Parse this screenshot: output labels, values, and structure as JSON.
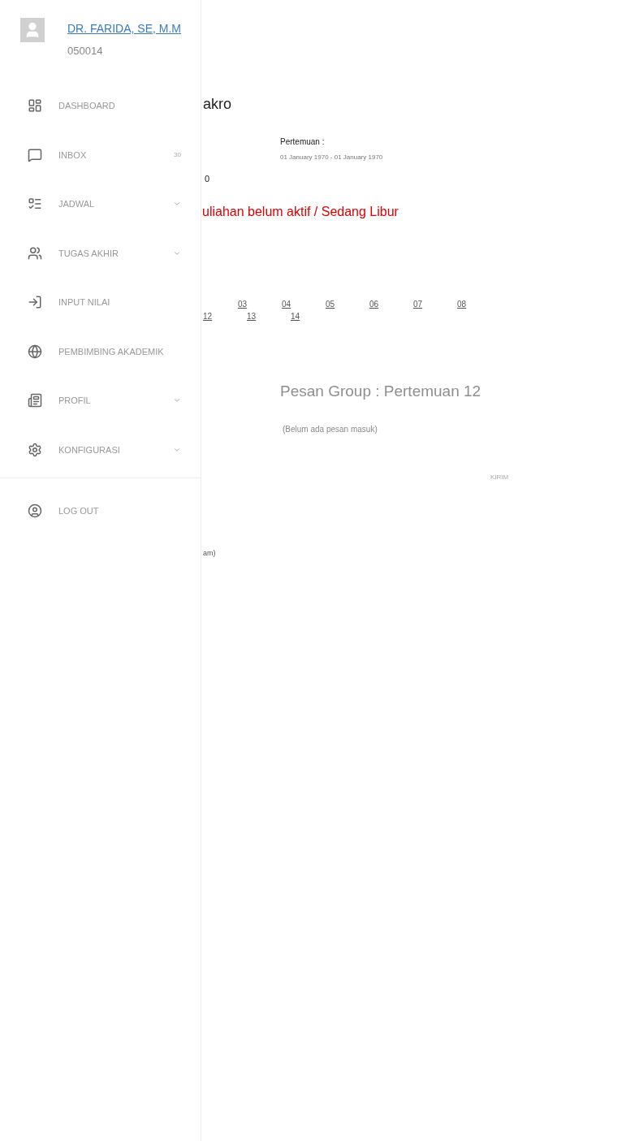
{
  "profile": {
    "name": "DR. FARIDA, SE, M.M",
    "id": "050014"
  },
  "menu": [
    {
      "label": "DASHBOARD",
      "kind": "dashboard",
      "expandable": false
    },
    {
      "label": "INBOX",
      "kind": "inbox",
      "expandable": false,
      "badge": "30"
    },
    {
      "label": "JADWAL",
      "kind": "schedule",
      "expandable": true
    },
    {
      "label": "TUGAS AKHIR",
      "kind": "people",
      "expandable": true
    },
    {
      "label": "INPUT NILAI",
      "kind": "input",
      "expandable": false
    },
    {
      "label": "PEMBIMBING AKADEMIK",
      "kind": "globe",
      "expandable": false
    },
    {
      "label": "PROFIL",
      "kind": "profile",
      "expandable": true
    },
    {
      "label": "KONFIGURASI",
      "kind": "settings",
      "expandable": true
    }
  ],
  "logout": {
    "label": "LOG OUT"
  },
  "main": {
    "title": "akro",
    "meeting_label": "Pertemuan :",
    "meeting_dates": "01 January 1970 - 01 January 1970",
    "number": "0",
    "status": "uliahan belum aktif / Sedang Libur",
    "meeting_links": [
      [
        "03",
        "04",
        "05",
        "06",
        "07",
        "08"
      ],
      [
        "12",
        "13",
        "14"
      ]
    ],
    "chat_title": "Pesan Group : Pertemuan 12",
    "chat_empty": "(Belum ada pesan masuk)",
    "send": "KIRIM",
    "footer": "am)"
  }
}
